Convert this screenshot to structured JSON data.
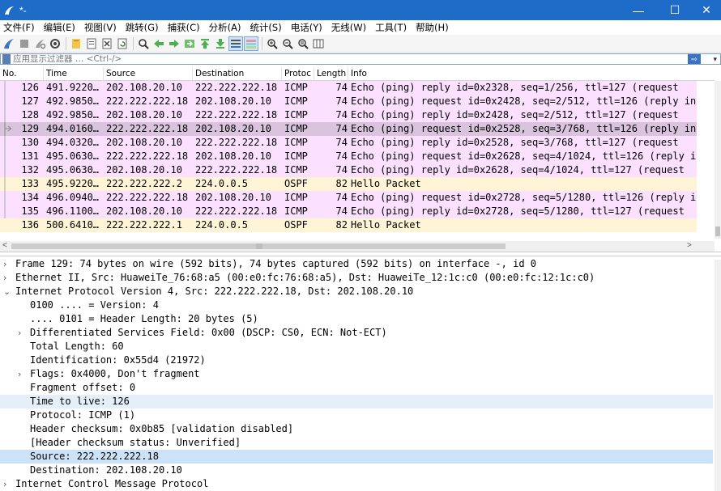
{
  "window": {
    "title": "*-",
    "minimize": "—",
    "maximize": "☐",
    "close": "✕"
  },
  "menu": [
    "文件(F)",
    "编辑(E)",
    "视图(V)",
    "跳转(G)",
    "捕获(C)",
    "分析(A)",
    "统计(S)",
    "电话(Y)",
    "无线(W)",
    "工具(T)",
    "帮助(H)"
  ],
  "toolbar": [
    "shark-fin-icon",
    "stop-icon",
    "restart-icon",
    "options-gear-icon",
    "open-folder-icon",
    "save-file-icon",
    "close-file-icon",
    "reload-icon",
    "find-icon",
    "back-icon",
    "forward-icon",
    "go-to-packet-icon",
    "first-packet-icon",
    "last-packet-icon",
    "autoscroll-icon",
    "colorize-icon",
    "zoom-in-icon",
    "zoom-out-icon",
    "zoom-reset-icon",
    "resize-columns-icon"
  ],
  "filter": {
    "placeholder": "应用显示过滤器 … <Ctrl-/>",
    "apply_icon": "⇨",
    "dropdown": "▾"
  },
  "packet_list": {
    "columns": [
      "No.",
      "Time",
      "Source",
      "Destination",
      "Protoc",
      "Length",
      "Info"
    ],
    "rows": [
      {
        "no": "126",
        "time": "491.9220…",
        "src": "202.108.20.10",
        "dst": "222.222.222.18",
        "proto": "ICMP",
        "len": "74",
        "info": "Echo (ping) reply    id=0x2328, seq=1/256, ttl=127 (request",
        "type": "icmp"
      },
      {
        "no": "127",
        "time": "492.9850…",
        "src": "222.222.222.18",
        "dst": "202.108.20.10",
        "proto": "ICMP",
        "len": "74",
        "info": "Echo (ping) request  id=0x2428, seq=2/512, ttl=126 (reply in",
        "type": "icmp"
      },
      {
        "no": "128",
        "time": "492.9850…",
        "src": "202.108.20.10",
        "dst": "222.222.222.18",
        "proto": "ICMP",
        "len": "74",
        "info": "Echo (ping) reply    id=0x2428, seq=2/512, ttl=127 (request",
        "type": "icmp"
      },
      {
        "no": "129",
        "time": "494.0160…",
        "src": "222.222.222.18",
        "dst": "202.108.20.10",
        "proto": "ICMP",
        "len": "74",
        "info": "Echo (ping) request  id=0x2528, seq=3/768, ttl=126 (reply in",
        "type": "selected"
      },
      {
        "no": "130",
        "time": "494.0320…",
        "src": "202.108.20.10",
        "dst": "222.222.222.18",
        "proto": "ICMP",
        "len": "74",
        "info": "Echo (ping) reply    id=0x2528, seq=3/768, ttl=127 (request",
        "type": "icmp"
      },
      {
        "no": "131",
        "time": "495.0630…",
        "src": "222.222.222.18",
        "dst": "202.108.20.10",
        "proto": "ICMP",
        "len": "74",
        "info": "Echo (ping) request  id=0x2628, seq=4/1024, ttl=126 (reply in",
        "type": "icmp"
      },
      {
        "no": "132",
        "time": "495.0630…",
        "src": "202.108.20.10",
        "dst": "222.222.222.18",
        "proto": "ICMP",
        "len": "74",
        "info": "Echo (ping) reply    id=0x2628, seq=4/1024, ttl=127 (request",
        "type": "icmp"
      },
      {
        "no": "133",
        "time": "495.9220…",
        "src": "222.222.222.2",
        "dst": "224.0.0.5",
        "proto": "OSPF",
        "len": "82",
        "info": "Hello Packet",
        "type": "ospf"
      },
      {
        "no": "134",
        "time": "496.0940…",
        "src": "222.222.222.18",
        "dst": "202.108.20.10",
        "proto": "ICMP",
        "len": "74",
        "info": "Echo (ping) request  id=0x2728, seq=5/1280, ttl=126 (reply in",
        "type": "icmp"
      },
      {
        "no": "135",
        "time": "496.1100…",
        "src": "202.108.20.10",
        "dst": "222.222.222.18",
        "proto": "ICMP",
        "len": "74",
        "info": "Echo (ping) reply    id=0x2728, seq=5/1280, ttl=127 (request",
        "type": "icmp"
      },
      {
        "no": "136",
        "time": "500.6410…",
        "src": "222.222.222.1",
        "dst": "224.0.0.5",
        "proto": "OSPF",
        "len": "82",
        "info": "Hello Packet",
        "type": "ospf"
      }
    ]
  },
  "details": [
    {
      "arrow": ">",
      "indent": 0,
      "text": "Frame 129: 74 bytes on wire (592 bits), 74 bytes captured (592 bits) on interface -, id 0",
      "hl": false
    },
    {
      "arrow": ">",
      "indent": 0,
      "text": "Ethernet II, Src: HuaweiTe_76:68:a5 (00:e0:fc:76:68:a5), Dst: HuaweiTe_12:1c:c0 (00:e0:fc:12:1c:c0)",
      "hl": false
    },
    {
      "arrow": "v",
      "indent": 0,
      "text": "Internet Protocol Version 4, Src: 222.222.222.18, Dst: 202.108.20.10",
      "hl": false
    },
    {
      "arrow": "",
      "indent": 1,
      "text": "0100 .... = Version: 4",
      "hl": false
    },
    {
      "arrow": "",
      "indent": 1,
      "text": ".... 0101 = Header Length: 20 bytes (5)",
      "hl": false
    },
    {
      "arrow": ">",
      "indent": 1,
      "text": "Differentiated Services Field: 0x00 (DSCP: CS0, ECN: Not-ECT)",
      "hl": false
    },
    {
      "arrow": "",
      "indent": 1,
      "text": "Total Length: 60",
      "hl": false
    },
    {
      "arrow": "",
      "indent": 1,
      "text": "Identification: 0x55d4 (21972)",
      "hl": false
    },
    {
      "arrow": ">",
      "indent": 1,
      "text": "Flags: 0x4000, Don't fragment",
      "hl": false
    },
    {
      "arrow": "",
      "indent": 1,
      "text": "Fragment offset: 0",
      "hl": false
    },
    {
      "arrow": "",
      "indent": 1,
      "text": "Time to live: 126",
      "hl": true
    },
    {
      "arrow": "",
      "indent": 1,
      "text": "Protocol: ICMP (1)",
      "hl": false
    },
    {
      "arrow": "",
      "indent": 1,
      "text": "Header checksum: 0x0b85 [validation disabled]",
      "hl": false
    },
    {
      "arrow": "",
      "indent": 1,
      "text": "[Header checksum status: Unverified]",
      "hl": false
    },
    {
      "arrow": "",
      "indent": 1,
      "text": "Source: 222.222.222.18",
      "hl": "strong"
    },
    {
      "arrow": "",
      "indent": 1,
      "text": "Destination: 202.108.20.10",
      "hl": false
    },
    {
      "arrow": ">",
      "indent": 0,
      "text": "Internet Control Message Protocol",
      "hl": false
    }
  ],
  "colors": {
    "icmp": "#fce0ff",
    "ospf": "#fff5d6",
    "selected": "#d9c3dd",
    "detail_hl": "#e4effa",
    "detail_hl_strong": "#cce3f7",
    "titlebar": "#1e6cc8"
  }
}
